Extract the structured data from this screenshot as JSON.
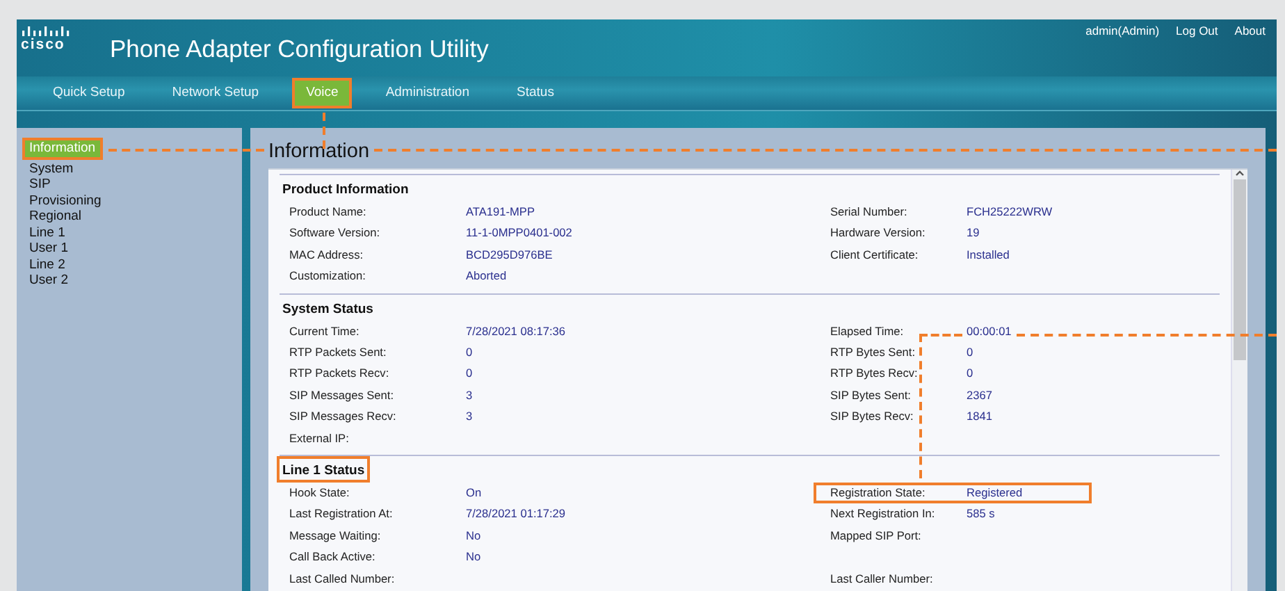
{
  "header": {
    "logo": "cisco",
    "title": "Phone Adapter Configuration Utility",
    "user_links": [
      {
        "label": "admin(Admin)"
      },
      {
        "label": "Log Out"
      },
      {
        "label": "About"
      }
    ]
  },
  "tabs": [
    {
      "label": "Quick Setup",
      "selected": false,
      "highlighted": false
    },
    {
      "label": "Network Setup",
      "selected": false,
      "highlighted": false
    },
    {
      "label": "Voice",
      "selected": true,
      "highlighted": true
    },
    {
      "label": "Administration",
      "selected": false,
      "highlighted": false
    },
    {
      "label": "Status",
      "selected": false,
      "highlighted": false
    }
  ],
  "sidebar": {
    "items": [
      {
        "label": "Information",
        "selected": true,
        "highlighted": true
      },
      {
        "label": "System",
        "selected": false,
        "highlighted": false
      },
      {
        "label": "SIP",
        "selected": false,
        "highlighted": false
      },
      {
        "label": "Provisioning",
        "selected": false,
        "highlighted": false
      },
      {
        "label": "Regional",
        "selected": false,
        "highlighted": false
      },
      {
        "label": "Line 1",
        "selected": false,
        "highlighted": false
      },
      {
        "label": "User 1",
        "selected": false,
        "highlighted": false
      },
      {
        "label": "Line 2",
        "selected": false,
        "highlighted": false
      },
      {
        "label": "User 2",
        "selected": false,
        "highlighted": false
      }
    ]
  },
  "page": {
    "title": "Information",
    "sections": [
      {
        "title": "Product Information",
        "highlighted": false,
        "rows": [
          {
            "left": {
              "label": "Product Name:",
              "value": "ATA191-MPP",
              "highlighted": false
            },
            "right": {
              "label": "Serial Number:",
              "value": "FCH25222WRW",
              "highlighted": false
            }
          },
          {
            "left": {
              "label": "Software Version:",
              "value": "11-1-0MPP0401-002",
              "highlighted": false
            },
            "right": {
              "label": "Hardware Version:",
              "value": "19",
              "highlighted": false
            }
          },
          {
            "left": {
              "label": "MAC Address:",
              "value": "BCD295D976BE",
              "highlighted": false
            },
            "right": {
              "label": "Client Certificate:",
              "value": "Installed",
              "highlighted": false
            }
          },
          {
            "left": {
              "label": "Customization:",
              "value": "Aborted",
              "highlighted": false
            }
          }
        ]
      },
      {
        "title": "System Status",
        "highlighted": false,
        "rows": [
          {
            "left": {
              "label": "Current Time:",
              "value": "7/28/2021 08:17:36",
              "highlighted": false
            },
            "right": {
              "label": "Elapsed Time:",
              "value": "00:00:01",
              "highlighted": false
            }
          },
          {
            "left": {
              "label": "RTP Packets Sent:",
              "value": "0",
              "highlighted": false
            },
            "right": {
              "label": "RTP Bytes Sent:",
              "value": "0",
              "highlighted": false
            }
          },
          {
            "left": {
              "label": "RTP Packets Recv:",
              "value": "0",
              "highlighted": false
            },
            "right": {
              "label": "RTP Bytes Recv:",
              "value": "0",
              "highlighted": false
            }
          },
          {
            "left": {
              "label": "SIP Messages Sent:",
              "value": "3",
              "highlighted": false
            },
            "right": {
              "label": "SIP Bytes Sent:",
              "value": "2367",
              "highlighted": false
            }
          },
          {
            "left": {
              "label": "SIP Messages Recv:",
              "value": "3",
              "highlighted": false
            },
            "right": {
              "label": "SIP Bytes Recv:",
              "value": "1841",
              "highlighted": false
            }
          },
          {
            "left": {
              "label": "External IP:",
              "highlighted": false
            }
          }
        ]
      },
      {
        "title": "Line 1 Status",
        "highlighted": true,
        "rows": [
          {
            "left": {
              "label": "Hook State:",
              "value": "On",
              "highlighted": false
            },
            "right": {
              "label": "Registration State:",
              "value": "Registered",
              "highlighted": true
            }
          },
          {
            "left": {
              "label": "Last Registration At:",
              "value": "7/28/2021 01:17:29",
              "highlighted": false
            },
            "right": {
              "label": "Next Registration In:",
              "value": "585 s",
              "highlighted": false
            }
          },
          {
            "left": {
              "label": "Message Waiting:",
              "value": "No",
              "highlighted": false
            },
            "right": {
              "label": "Mapped SIP Port:",
              "highlighted": false
            }
          },
          {
            "left": {
              "label": "Call Back Active:",
              "value": "No",
              "highlighted": false
            }
          },
          {
            "left": {
              "label": "Last Called Number:",
              "highlighted": false
            },
            "right": {
              "label": "Last Caller Number:",
              "highlighted": false
            }
          }
        ]
      }
    ]
  }
}
